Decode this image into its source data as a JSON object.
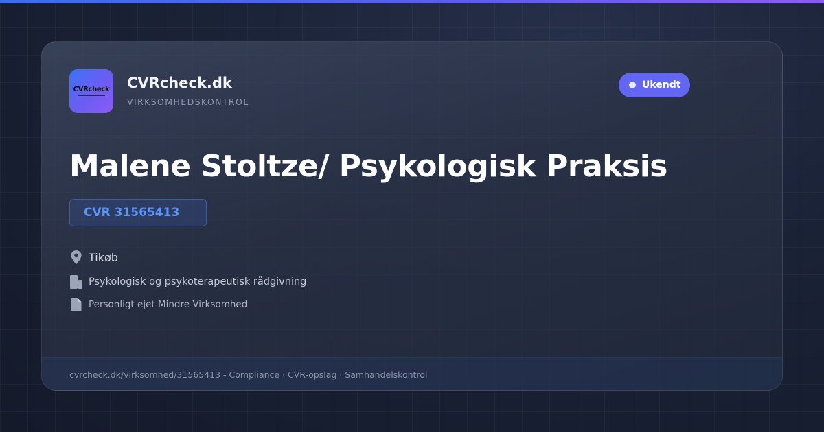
{
  "brand": {
    "logo_text": "CVRcheck",
    "name": "CVRcheck.dk",
    "tagline": "VIRKSOMHEDSKONTROL"
  },
  "status": {
    "label": "Ukendt",
    "color": "#6366f1"
  },
  "company": {
    "name": "Malene Stoltze/ Psykologisk Praksis",
    "cvr": "CVR 31565413",
    "city": "Tikøb",
    "industry": "Psykologisk og psykoterapeutisk rådgivning",
    "company_type": "Personligt ejet Mindre Virksomhed"
  },
  "icons": {
    "city": "map-pin-icon",
    "industry": "building-icon",
    "company_type": "document-icon"
  },
  "footer": {
    "text": "cvrcheck.dk/virksomhed/31565413 - Compliance · CVR-opslag · Samhandelskontrol"
  },
  "colors": {
    "accent_gradient_start": "#3b6cf2",
    "accent_gradient_end": "#8b5cf6",
    "cvr_text": "#5b94f5",
    "background": "#161d2e"
  }
}
